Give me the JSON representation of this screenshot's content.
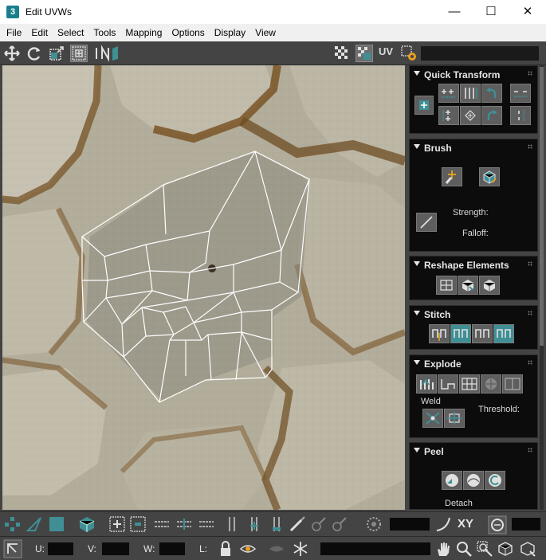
{
  "window": {
    "title": "Edit UVWs",
    "app_icon_glyph": "3",
    "minimize_glyph": "—",
    "maximize_glyph": "☐",
    "close_glyph": "✕"
  },
  "menu": {
    "items": [
      "File",
      "Edit",
      "Select",
      "Tools",
      "Mapping",
      "Options",
      "Display",
      "View"
    ]
  },
  "top_toolbar": {
    "uv_label": "UV",
    "icons": [
      "move-icon",
      "rotate-icon",
      "scale-icon",
      "freeform-icon",
      "mirror-icon",
      "checker-pattern-icon",
      "checker-select-icon",
      "settings-icon"
    ]
  },
  "rollouts": {
    "quick_transform": {
      "title": "Quick Transform"
    },
    "brush": {
      "title": "Brush",
      "strength_label": "Strength:",
      "falloff_label": "Falloff:"
    },
    "reshape": {
      "title": "Reshape Elements"
    },
    "stitch": {
      "title": "Stitch"
    },
    "explode": {
      "title": "Explode",
      "weld_label": "Weld",
      "threshold_label": "Threshold:"
    },
    "peel": {
      "title": "Peel",
      "detach_label": "Detach"
    }
  },
  "bottom_toolbar": {
    "xy_label": "XY",
    "u_label": "U:",
    "v_label": "V:",
    "w_label": "W:",
    "l_label": "L:"
  },
  "colors": {
    "accent_teal": "#3f8f95",
    "mesh_white": "#ffffff",
    "panel_black": "#0c0c0c",
    "toolbar_gray": "#444444"
  }
}
